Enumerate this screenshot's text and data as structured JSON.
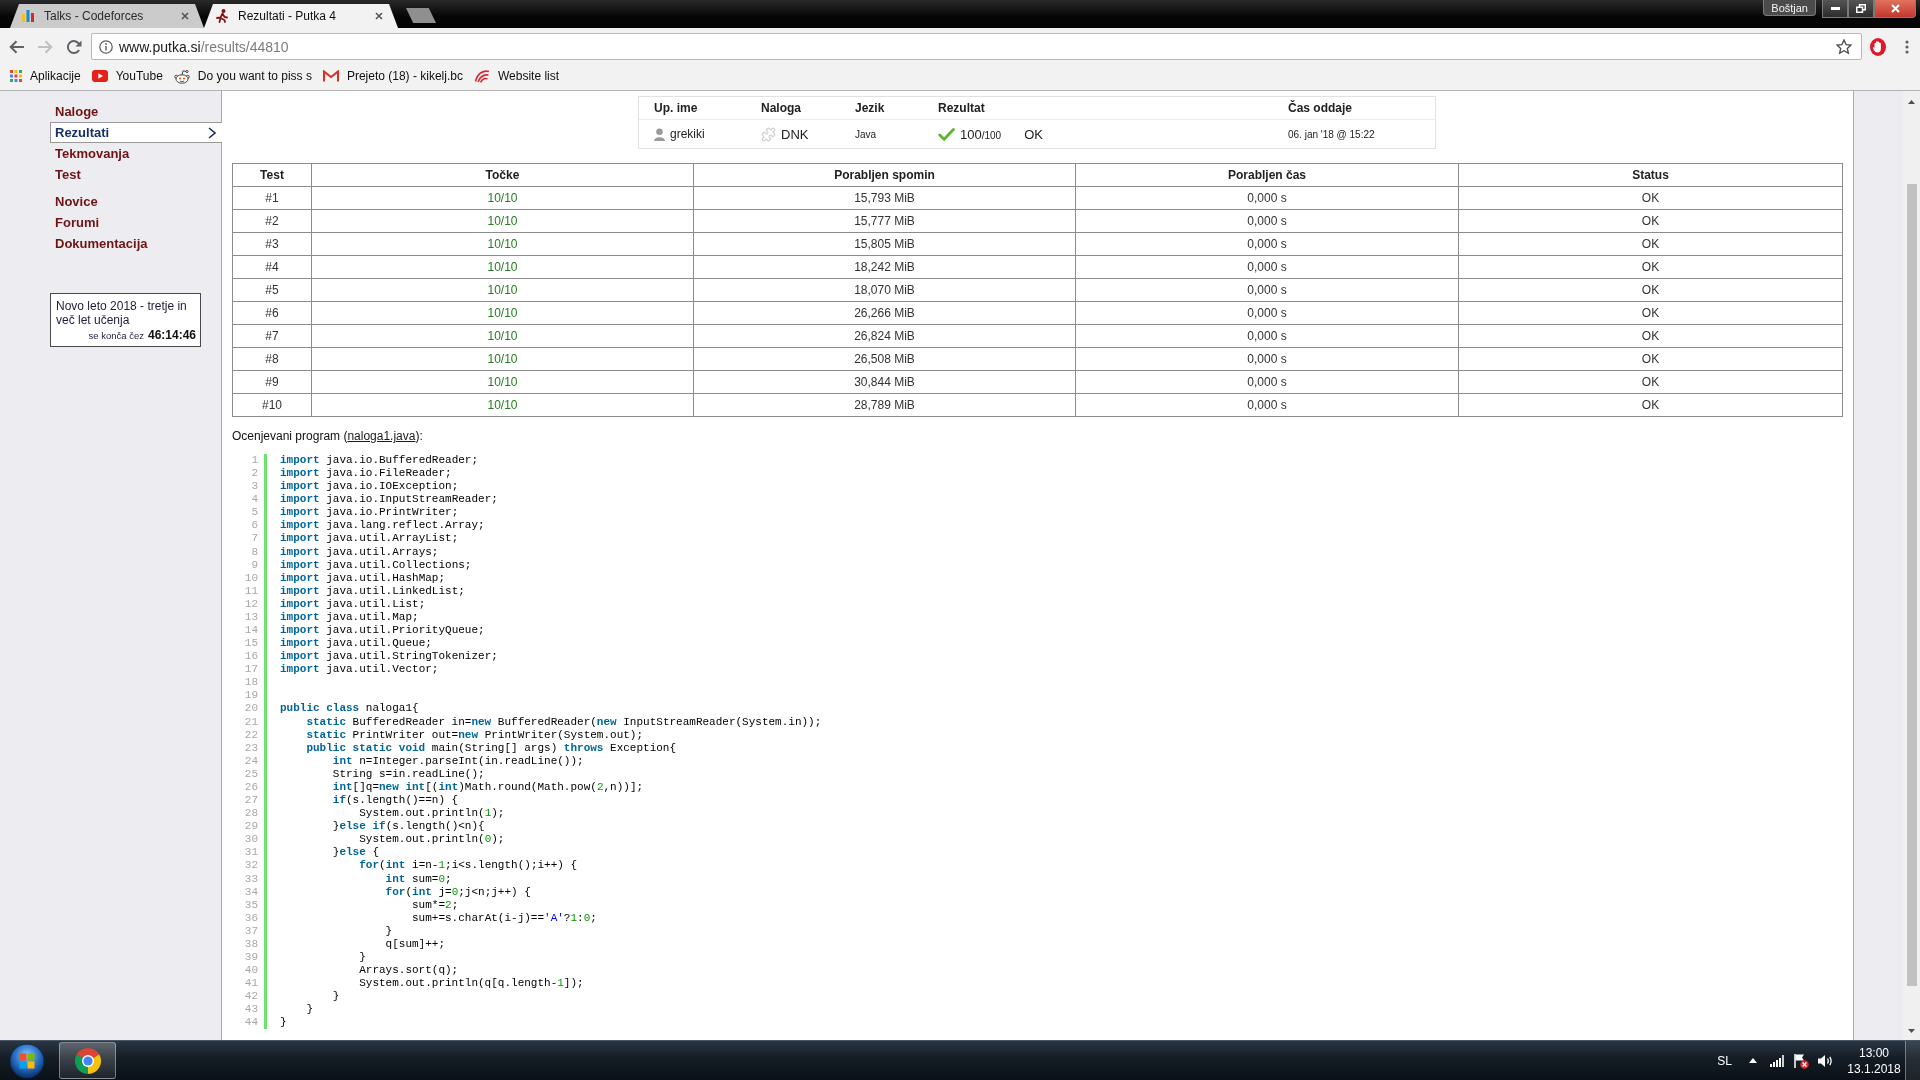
{
  "browser": {
    "tabs": [
      {
        "title": "Talks - Codeforces",
        "kind": "chart",
        "selected": false
      },
      {
        "title": "Rezultati - Putka 4",
        "kind": "runner",
        "selected": true
      }
    ],
    "profile": "Boštjan",
    "address": {
      "host": "www.putka.si",
      "path": "/results/44810"
    },
    "bookmarks": [
      {
        "label": "Aplikacije",
        "kind": "grid"
      },
      {
        "label": "YouTube",
        "kind": "play"
      },
      {
        "label": "Do you want to piss s",
        "kind": "alien"
      },
      {
        "label": "Prejeto (18) - kikelj.bc",
        "kind": "mail"
      },
      {
        "label": "Website list",
        "kind": "swirl"
      }
    ]
  },
  "sidebar": {
    "groups": [
      {
        "items": [
          {
            "label": "Naloge",
            "selected": false
          },
          {
            "label": "Rezultati",
            "selected": true
          },
          {
            "label": "Tekmovanja",
            "selected": false
          },
          {
            "label": "Test",
            "selected": false
          }
        ]
      },
      {
        "items": [
          {
            "label": "Novice",
            "selected": false
          },
          {
            "label": "Forumi",
            "selected": false
          },
          {
            "label": "Dokumentacija",
            "selected": false
          }
        ]
      }
    ],
    "countdown": {
      "title": "Novo leto 2018 - tretje in več let učenja",
      "label": "se konča čez",
      "remaining": "46:14:46"
    }
  },
  "submission": {
    "columns": [
      "Up. ime",
      "Naloga",
      "Jezik",
      "Rezultat",
      "Čas oddaje"
    ],
    "user": "grekiki",
    "task": "DNK",
    "language": "Java",
    "points": "100",
    "points_max": "/100",
    "verdict": "OK",
    "submitted": "06. jan '18 @ 15:22"
  },
  "results": {
    "columns": [
      "Test",
      "Točke",
      "Porabljen spomin",
      "Porabljen čas",
      "Status"
    ],
    "rows": [
      {
        "test": "#1",
        "points": "10/10",
        "memory": "15,793 MiB",
        "time": "0,000 s",
        "status": "OK"
      },
      {
        "test": "#2",
        "points": "10/10",
        "memory": "15,777 MiB",
        "time": "0,000 s",
        "status": "OK"
      },
      {
        "test": "#3",
        "points": "10/10",
        "memory": "15,805 MiB",
        "time": "0,000 s",
        "status": "OK"
      },
      {
        "test": "#4",
        "points": "10/10",
        "memory": "18,242 MiB",
        "time": "0,000 s",
        "status": "OK"
      },
      {
        "test": "#5",
        "points": "10/10",
        "memory": "18,070 MiB",
        "time": "0,000 s",
        "status": "OK"
      },
      {
        "test": "#6",
        "points": "10/10",
        "memory": "26,266 MiB",
        "time": "0,000 s",
        "status": "OK"
      },
      {
        "test": "#7",
        "points": "10/10",
        "memory": "26,824 MiB",
        "time": "0,000 s",
        "status": "OK"
      },
      {
        "test": "#8",
        "points": "10/10",
        "memory": "26,508 MiB",
        "time": "0,000 s",
        "status": "OK"
      },
      {
        "test": "#9",
        "points": "10/10",
        "memory": "30,844 MiB",
        "time": "0,000 s",
        "status": "OK"
      },
      {
        "test": "#10",
        "points": "10/10",
        "memory": "28,789 MiB",
        "time": "0,000 s",
        "status": "OK"
      }
    ]
  },
  "program": {
    "caption": {
      "before": "Ocenjevani program (",
      "link": "naloga1.java",
      "after": "):"
    },
    "lines": [
      {
        "number": "1",
        "tokens": [
          {
            "kind": "keyword",
            "text": "import"
          },
          {
            "kind": "plain",
            "text": " java.io.BufferedReader;"
          }
        ]
      },
      {
        "number": "2",
        "tokens": [
          {
            "kind": "keyword",
            "text": "import"
          },
          {
            "kind": "plain",
            "text": " java.io.FileReader;"
          }
        ]
      },
      {
        "number": "3",
        "tokens": [
          {
            "kind": "keyword",
            "text": "import"
          },
          {
            "kind": "plain",
            "text": " java.io.IOException;"
          }
        ]
      },
      {
        "number": "4",
        "tokens": [
          {
            "kind": "keyword",
            "text": "import"
          },
          {
            "kind": "plain",
            "text": " java.io.InputStreamReader;"
          }
        ]
      },
      {
        "number": "5",
        "tokens": [
          {
            "kind": "keyword",
            "text": "import"
          },
          {
            "kind": "plain",
            "text": " java.io.PrintWriter;"
          }
        ]
      },
      {
        "number": "6",
        "tokens": [
          {
            "kind": "keyword",
            "text": "import"
          },
          {
            "kind": "plain",
            "text": " java.lang.reflect.Array;"
          }
        ]
      },
      {
        "number": "7",
        "tokens": [
          {
            "kind": "keyword",
            "text": "import"
          },
          {
            "kind": "plain",
            "text": " java.util.ArrayList;"
          }
        ]
      },
      {
        "number": "8",
        "tokens": [
          {
            "kind": "keyword",
            "text": "import"
          },
          {
            "kind": "plain",
            "text": " java.util.Arrays;"
          }
        ]
      },
      {
        "number": "9",
        "tokens": [
          {
            "kind": "keyword",
            "text": "import"
          },
          {
            "kind": "plain",
            "text": " java.util.Collections;"
          }
        ]
      },
      {
        "number": "10",
        "tokens": [
          {
            "kind": "keyword",
            "text": "import"
          },
          {
            "kind": "plain",
            "text": " java.util.HashMap;"
          }
        ]
      },
      {
        "number": "11",
        "tokens": [
          {
            "kind": "keyword",
            "text": "import"
          },
          {
            "kind": "plain",
            "text": " java.util.LinkedList;"
          }
        ]
      },
      {
        "number": "12",
        "tokens": [
          {
            "kind": "keyword",
            "text": "import"
          },
          {
            "kind": "plain",
            "text": " java.util.List;"
          }
        ]
      },
      {
        "number": "13",
        "tokens": [
          {
            "kind": "keyword",
            "text": "import"
          },
          {
            "kind": "plain",
            "text": " java.util.Map;"
          }
        ]
      },
      {
        "number": "14",
        "tokens": [
          {
            "kind": "keyword",
            "text": "import"
          },
          {
            "kind": "plain",
            "text": " java.util.PriorityQueue;"
          }
        ]
      },
      {
        "number": "15",
        "tokens": [
          {
            "kind": "keyword",
            "text": "import"
          },
          {
            "kind": "plain",
            "text": " java.util.Queue;"
          }
        ]
      },
      {
        "number": "16",
        "tokens": [
          {
            "kind": "keyword",
            "text": "import"
          },
          {
            "kind": "plain",
            "text": " java.util.StringTokenizer;"
          }
        ]
      },
      {
        "number": "17",
        "tokens": [
          {
            "kind": "keyword",
            "text": "import"
          },
          {
            "kind": "plain",
            "text": " java.util.Vector;"
          }
        ]
      },
      {
        "number": "18"
      },
      {
        "number": "19"
      },
      {
        "number": "20",
        "tokens": [
          {
            "kind": "keyword",
            "text": "public class"
          },
          {
            "kind": "plain",
            "text": " naloga1{"
          }
        ]
      },
      {
        "number": "21",
        "tokens": [
          {
            "kind": "keyword",
            "text": "    static"
          },
          {
            "kind": "plain",
            "text": " BufferedReader in="
          },
          {
            "kind": "keyword",
            "text": "new"
          },
          {
            "kind": "plain",
            "text": " BufferedReader("
          },
          {
            "kind": "keyword",
            "text": "new"
          },
          {
            "kind": "plain",
            "text": " InputStreamReader(System.in));"
          }
        ]
      },
      {
        "number": "22",
        "tokens": [
          {
            "kind": "keyword",
            "text": "    static"
          },
          {
            "kind": "plain",
            "text": " PrintWriter out="
          },
          {
            "kind": "keyword",
            "text": "new"
          },
          {
            "kind": "plain",
            "text": " PrintWriter(System.out);"
          }
        ]
      },
      {
        "number": "23",
        "tokens": [
          {
            "kind": "keyword",
            "text": "    public static void"
          },
          {
            "kind": "plain",
            "text": " main(String[] args) "
          },
          {
            "kind": "keyword",
            "text": "throws"
          },
          {
            "kind": "plain",
            "text": " Exception{"
          }
        ]
      },
      {
        "number": "24",
        "tokens": [
          {
            "kind": "keyword",
            "text": "        int"
          },
          {
            "kind": "plain",
            "text": " n=Integer.parseInt(in.readLine());"
          }
        ]
      },
      {
        "number": "25",
        "tokens": [
          {
            "kind": "plain",
            "text": "        String s=in.readLine();"
          }
        ]
      },
      {
        "number": "26",
        "tokens": [
          {
            "kind": "keyword",
            "text": "        int"
          },
          {
            "kind": "plain",
            "text": "[]q="
          },
          {
            "kind": "keyword",
            "text": "new int"
          },
          {
            "kind": "plain",
            "text": "[("
          },
          {
            "kind": "keyword",
            "text": "int"
          },
          {
            "kind": "plain",
            "text": ")Math.round(Math.pow("
          },
          {
            "kind": "number",
            "text": "2"
          },
          {
            "kind": "plain",
            "text": ",n))];"
          }
        ]
      },
      {
        "number": "27",
        "tokens": [
          {
            "kind": "keyword",
            "text": "        if"
          },
          {
            "kind": "plain",
            "text": "(s.length()==n) {"
          }
        ]
      },
      {
        "number": "28",
        "tokens": [
          {
            "kind": "plain",
            "text": "            System.out.println("
          },
          {
            "kind": "number",
            "text": "1"
          },
          {
            "kind": "plain",
            "text": ");"
          }
        ]
      },
      {
        "number": "29",
        "tokens": [
          {
            "kind": "plain",
            "text": "        }"
          },
          {
            "kind": "keyword",
            "text": "else if"
          },
          {
            "kind": "plain",
            "text": "(s.length()<n){"
          }
        ]
      },
      {
        "number": "30",
        "tokens": [
          {
            "kind": "plain",
            "text": "            System.out.println("
          },
          {
            "kind": "number",
            "text": "0"
          },
          {
            "kind": "plain",
            "text": ");"
          }
        ]
      },
      {
        "number": "31",
        "tokens": [
          {
            "kind": "plain",
            "text": "        }"
          },
          {
            "kind": "keyword",
            "text": "else"
          },
          {
            "kind": "plain",
            "text": " {"
          }
        ]
      },
      {
        "number": "32",
        "tokens": [
          {
            "kind": "keyword",
            "text": "            for"
          },
          {
            "kind": "plain",
            "text": "("
          },
          {
            "kind": "keyword",
            "text": "int"
          },
          {
            "kind": "plain",
            "text": " i=n-"
          },
          {
            "kind": "number",
            "text": "1"
          },
          {
            "kind": "plain",
            "text": ";i<s.length();i++) {"
          }
        ]
      },
      {
        "number": "33",
        "tokens": [
          {
            "kind": "keyword",
            "text": "                int"
          },
          {
            "kind": "plain",
            "text": " sum="
          },
          {
            "kind": "number",
            "text": "0"
          },
          {
            "kind": "plain",
            "text": ";"
          }
        ]
      },
      {
        "number": "34",
        "tokens": [
          {
            "kind": "keyword",
            "text": "                for"
          },
          {
            "kind": "plain",
            "text": "("
          },
          {
            "kind": "keyword",
            "text": "int"
          },
          {
            "kind": "plain",
            "text": " j="
          },
          {
            "kind": "number",
            "text": "0"
          },
          {
            "kind": "plain",
            "text": ";j<n;j++) {"
          }
        ]
      },
      {
        "number": "35",
        "tokens": [
          {
            "kind": "plain",
            "text": "                    sum*="
          },
          {
            "kind": "number",
            "text": "2"
          },
          {
            "kind": "plain",
            "text": ";"
          }
        ]
      },
      {
        "number": "36",
        "tokens": [
          {
            "kind": "plain",
            "text": "                    sum+=s.charAt(i-j)=="
          },
          {
            "kind": "string",
            "text": "'A'"
          },
          {
            "kind": "plain",
            "text": "?"
          },
          {
            "kind": "number",
            "text": "1"
          },
          {
            "kind": "plain",
            "text": ":"
          },
          {
            "kind": "number",
            "text": "0"
          },
          {
            "kind": "plain",
            "text": ";"
          }
        ]
      },
      {
        "number": "37",
        "tokens": [
          {
            "kind": "plain",
            "text": "                }"
          }
        ]
      },
      {
        "number": "38",
        "tokens": [
          {
            "kind": "plain",
            "text": "                q[sum]++;"
          }
        ]
      },
      {
        "number": "39",
        "tokens": [
          {
            "kind": "plain",
            "text": "            }"
          }
        ]
      },
      {
        "number": "40",
        "tokens": [
          {
            "kind": "plain",
            "text": "            Arrays.sort(q);"
          }
        ]
      },
      {
        "number": "41",
        "tokens": [
          {
            "kind": "plain",
            "text": "            System.out.println(q[q.length-"
          },
          {
            "kind": "number",
            "text": "1"
          },
          {
            "kind": "plain",
            "text": "]);"
          }
        ]
      },
      {
        "number": "42",
        "tokens": [
          {
            "kind": "plain",
            "text": "        }"
          }
        ]
      },
      {
        "number": "43",
        "tokens": [
          {
            "kind": "plain",
            "text": "    }"
          }
        ]
      },
      {
        "number": "44",
        "tokens": [
          {
            "kind": "plain",
            "text": "}"
          }
        ]
      }
    ]
  },
  "taskbar": {
    "language": "SL",
    "time": "13:00",
    "date": "13.1.2018"
  }
}
